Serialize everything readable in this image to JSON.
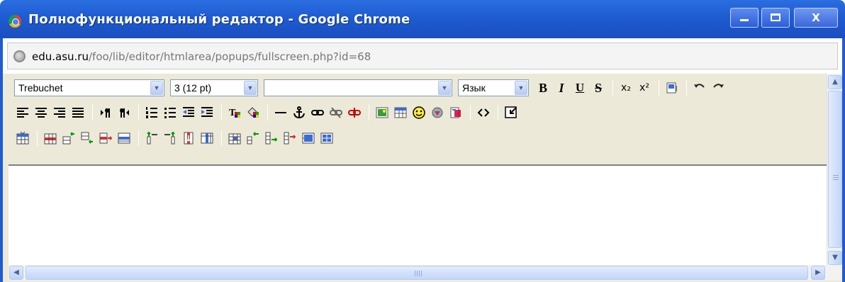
{
  "window": {
    "title": "Полнофункциональный редактор - Google Chrome",
    "close_glyph": "X",
    "accent": "#1f5bd1"
  },
  "address": {
    "host": "edu.asu.ru",
    "path": "/foo/lib/editor/htmlarea/popups/fullscreen.php?id=68"
  },
  "toolbar": {
    "font_family": "Trebuchet",
    "font_size": "3 (12 pt)",
    "format_block": "",
    "language": "Язык",
    "bold": "B",
    "italic": "I",
    "underline": "U",
    "strike": "S",
    "subscript": "x₂",
    "superscript": "x²"
  },
  "icons": [
    "clean-word-icon",
    "undo-icon",
    "redo-icon",
    "justify-left-icon",
    "justify-center-icon",
    "justify-right-icon",
    "justify-full-icon",
    "ltr-icon",
    "rtl-icon",
    "ordered-list-icon",
    "unordered-list-icon",
    "outdent-icon",
    "indent-icon",
    "text-color-icon",
    "background-color-icon",
    "horizontal-rule-icon",
    "anchor-icon",
    "link-icon",
    "nolink-icon",
    "unlink-icon",
    "image-icon",
    "table-icon",
    "smiley-icon",
    "insert-char-icon",
    "search-replace-icon",
    "html-mode-icon",
    "fullscreen-icon",
    "table-properties-icon",
    "row-properties-icon",
    "insert-row-before-icon",
    "insert-row-after-icon",
    "delete-row-icon",
    "split-row-icon",
    "insert-column-before-icon",
    "insert-column-after-icon",
    "delete-column-icon",
    "split-column-icon",
    "cell-properties-icon",
    "insert-cell-before-icon",
    "insert-cell-after-icon",
    "delete-cell-icon",
    "merge-cells-icon",
    "split-cell-icon"
  ]
}
